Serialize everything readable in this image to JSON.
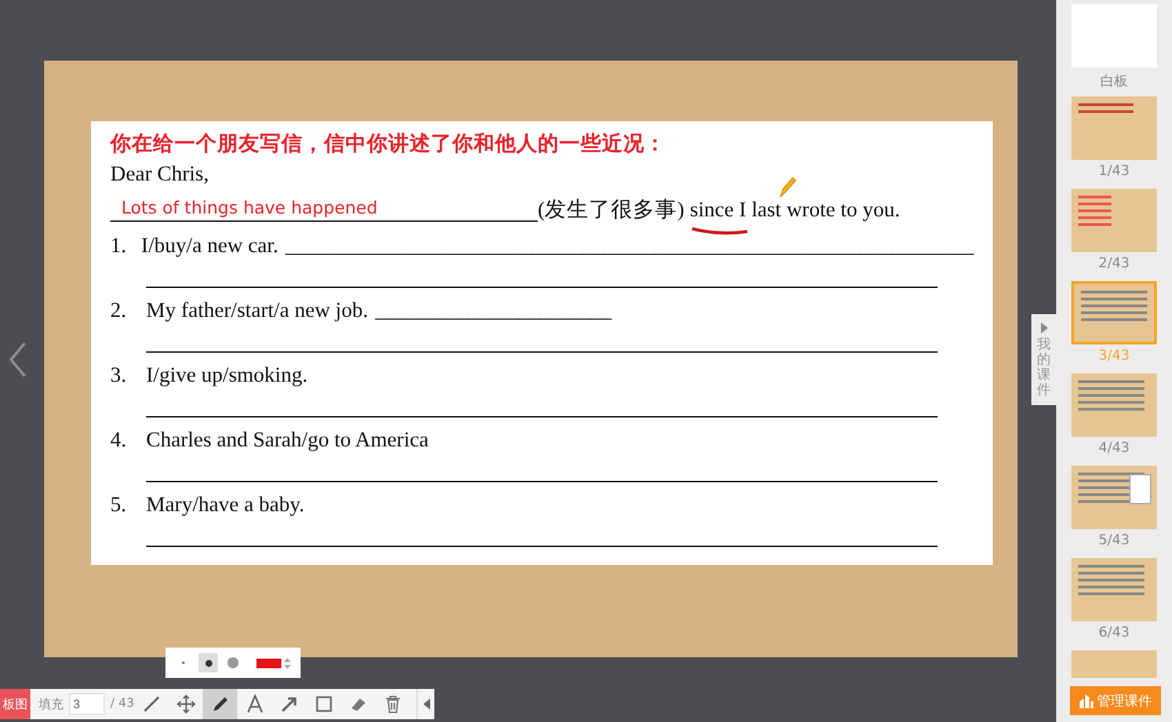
{
  "slide": {
    "instruction": "你在给一个朋友写信，信中你讲述了你和他人的一些近况：",
    "salutation": "Dear Chris,",
    "handwritten_answer": "Lots of things have happened",
    "sentence_hint": "(发生了很多事)",
    "sentence_end": "since I last wrote to you.",
    "items": [
      {
        "number": "1.",
        "prompt": "I/buy/a new car.",
        "blank": "___________________________________________________________________"
      },
      {
        "number": "2.",
        "prompt": "My father/start/a new job.",
        "blank": "_______________________"
      },
      {
        "number": "3.",
        "prompt": "I/give up/smoking."
      },
      {
        "number": "4.",
        "prompt": "Charles and Sarah/go to America"
      },
      {
        "number": "5.",
        "prompt": "Mary/have a baby."
      }
    ]
  },
  "side_tab": {
    "label": "我的课件"
  },
  "sidebar": {
    "items": [
      {
        "label": "白板",
        "kind": "whiteboard",
        "selected": false
      },
      {
        "label": "1/43",
        "kind": "title",
        "selected": false
      },
      {
        "label": "2/43",
        "kind": "notes",
        "selected": false
      },
      {
        "label": "3/43",
        "kind": "lines",
        "selected": true
      },
      {
        "label": "4/43",
        "kind": "lines",
        "selected": false
      },
      {
        "label": "5/43",
        "kind": "picture",
        "selected": false
      },
      {
        "label": "6/43",
        "kind": "lines",
        "selected": false
      }
    ],
    "manage_button": "管理课件"
  },
  "pen_popup": {
    "sizes": [
      {
        "kind": "small",
        "selected": false
      },
      {
        "kind": "medium",
        "selected": true
      },
      {
        "kind": "large",
        "selected": false
      }
    ],
    "color": "#e8141b"
  },
  "toolbar": {
    "board_button": "板图",
    "fill_label": "填充",
    "page": "3",
    "total": "/ 43",
    "tools": [
      {
        "kind": "line",
        "selected": false
      },
      {
        "kind": "move",
        "selected": false
      },
      {
        "kind": "pen",
        "selected": true
      },
      {
        "kind": "text",
        "selected": false
      },
      {
        "kind": "arrow",
        "selected": false
      },
      {
        "kind": "rect",
        "selected": false
      },
      {
        "kind": "eraser",
        "selected": false
      },
      {
        "kind": "trash",
        "selected": false
      }
    ]
  }
}
